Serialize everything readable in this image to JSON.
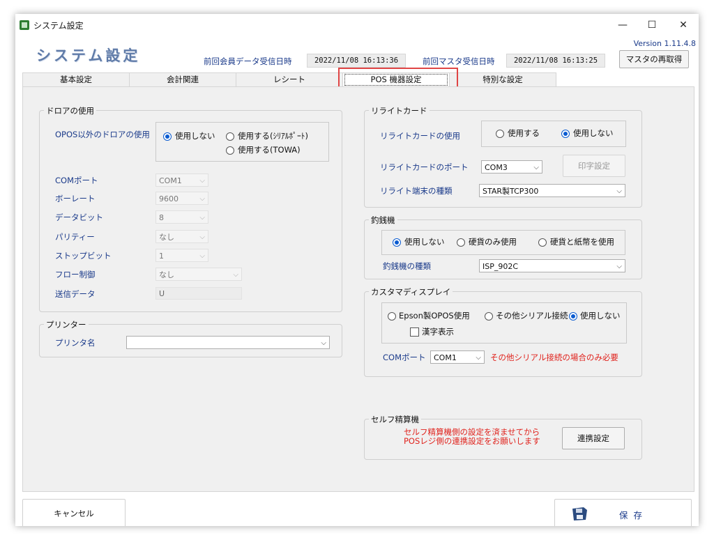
{
  "window": {
    "title": "システム設定",
    "minimize": "—",
    "maximize": "☐",
    "close": "✕"
  },
  "header": {
    "app_title": "システム設定",
    "version": "Version 1.11.4.8",
    "last_member_label": "前回会員データ受信日時",
    "last_member_value": "2022/11/08 16:13:36",
    "last_master_label": "前回マスタ受信日時",
    "last_master_value": "2022/11/08 16:13:25",
    "refetch_button": "マスタの再取得"
  },
  "tabs": [
    {
      "label": "基本設定"
    },
    {
      "label": "会計関連"
    },
    {
      "label": "レシート"
    },
    {
      "label": "POS 機器設定"
    },
    {
      "label": "特別な設定"
    }
  ],
  "drawer": {
    "legend": "ドロアの使用",
    "non_opos_label": "OPOS以外のドロアの使用",
    "opt_not_use": "使用しない",
    "opt_serial": "使用する(ｼﾘｱﾙﾎﾟｰﾄ)",
    "opt_towa": "使用する(TOWA)",
    "selected": "使用しない",
    "com_port_label": "COMポート",
    "com_port_value": "COM1",
    "baud_label": "ボーレート",
    "baud_value": "9600",
    "databit_label": "データビット",
    "databit_value": "8",
    "parity_label": "パリティー",
    "parity_value": "なし",
    "stopbit_label": "ストップビット",
    "stopbit_value": "1",
    "flow_label": "フロー制御",
    "flow_value": "なし",
    "senddata_label": "送信データ",
    "senddata_value": "U"
  },
  "printer": {
    "legend": "プリンター",
    "name_label": "プリンタ名",
    "name_value": ""
  },
  "rewrite": {
    "legend": "リライトカード",
    "use_label": "リライトカードの使用",
    "opt_use": "使用する",
    "opt_not_use": "使用しない",
    "selected": "使用しない",
    "port_label": "リライトカードのポート",
    "port_value": "COM3",
    "print_settings_button": "印字設定",
    "terminal_label": "リライト端末の種類",
    "terminal_value": "STAR製TCP300"
  },
  "changer": {
    "legend": "釣銭機",
    "opt_not_use": "使用しない",
    "opt_coin_only": "硬貨のみ使用",
    "opt_coin_bill": "硬貨と紙幣を使用",
    "selected": "使用しない",
    "type_label": "釣銭機の種類",
    "type_value": "ISP_902C"
  },
  "customer_display": {
    "legend": "カスタマディスプレイ",
    "opt_epson": "Epson製OPOS使用",
    "opt_other_serial": "その他シリアル接続",
    "opt_not_use": "使用しない",
    "selected": "使用しない",
    "kanji_label": "漢字表示",
    "kanji_checked": false,
    "com_label": "COMポート",
    "com_value": "COM1",
    "note": "その他シリアル接続の場合のみ必要"
  },
  "self_checkout": {
    "legend": "セルフ精算機",
    "note_line1": "セルフ精算機側の設定を済ませてから",
    "note_line2": "POSレジ側の連携設定をお願いします",
    "link_button": "連携設定"
  },
  "footer": {
    "cancel": "キャンセル",
    "save": "保 存"
  },
  "colors": {
    "accent_blue": "#1a3a8a",
    "radio_blue": "#0a5bd0",
    "note_red": "#e0221c",
    "highlight_red": "#e04545"
  },
  "icons": [
    "app-icon",
    "floppy-disk-icon",
    "chevron-down-icon"
  ]
}
